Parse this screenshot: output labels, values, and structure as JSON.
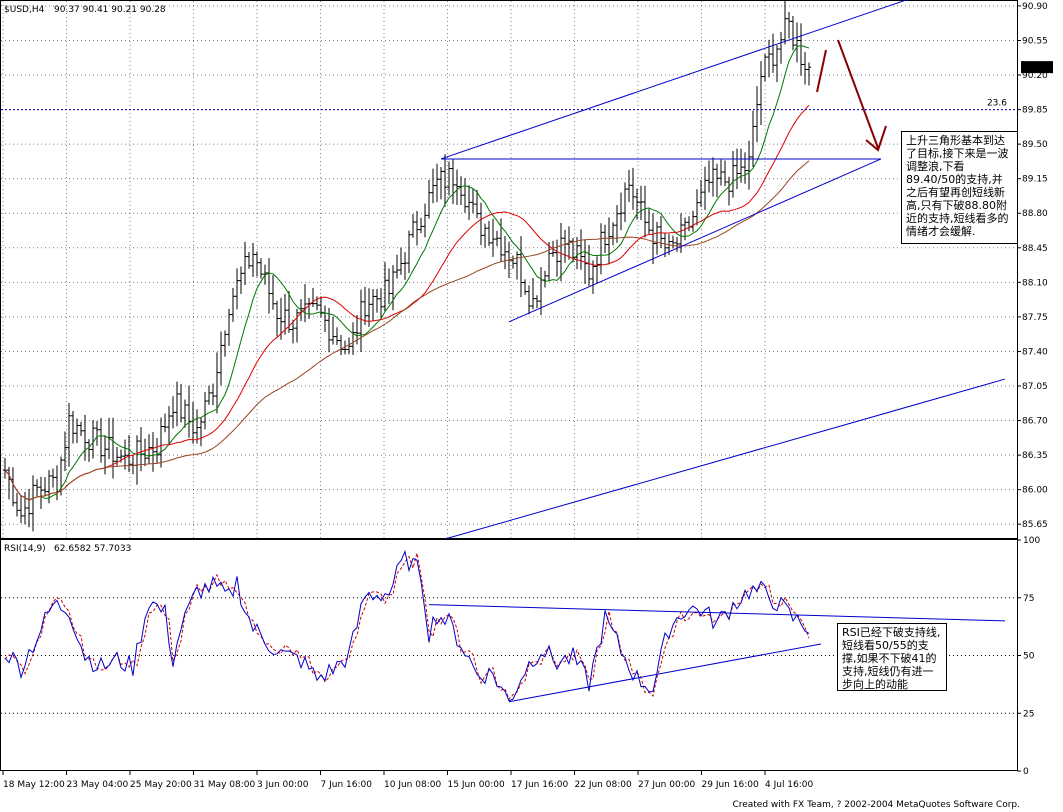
{
  "header": {
    "symbol_title": "$USD,H4",
    "ohlc": "90.37 90.41 90.21 90.28"
  },
  "rsi_header": {
    "title": "RSI(14,9)",
    "values": "62.6582 57.7033"
  },
  "footer": "Created with FX Team, ? 2002-2004 MetaQuotes Software Corp.",
  "annotations": {
    "price_note": "上升三角形基本到达了目标,接下来是一波调整浪,下看89.40/50的支持,并之后有望再创短线新高,只有下破88.80附近的支持,短线看多的情绪才会缓解.",
    "rsi_note": "RSI已经下破支持线,短线看50/55的支撑,如果不下破41的支持,短线仍有进一步向上的动能",
    "fib_label": "23.6"
  },
  "colors": {
    "grid": "#000000",
    "bars": "#000000",
    "ma_fast": "#007700",
    "ma_mid": "#dd0000",
    "ma_slow": "#994422",
    "trendline": "#0000cc",
    "rsi_line": "#0000cc",
    "rsi_signal": "#cc0000",
    "arrow": "#880000",
    "price_box_bg": "#000000",
    "price_box_fg": "#ffffff"
  },
  "chart_data": [
    {
      "type": "line",
      "title": "$USD,H4",
      "chart_style": "ohlc-bars",
      "ylim": [
        85.5,
        90.95
      ],
      "yticks": [
        "90.90",
        "90.55",
        "90.20",
        "89.85",
        "89.50",
        "89.15",
        "88.80",
        "88.45",
        "88.10",
        "87.75",
        "87.40",
        "87.05",
        "86.70",
        "86.35",
        "86.00",
        "85.65"
      ],
      "y_tick_values": [
        90.9,
        90.55,
        90.2,
        89.85,
        89.5,
        89.15,
        88.8,
        88.45,
        88.1,
        87.75,
        87.4,
        87.05,
        86.7,
        86.35,
        86.0,
        85.65
      ],
      "current_price": "90.28",
      "grid": "dotted",
      "x_categories": [
        "18 May 12:00",
        "23 May 04:00",
        "25 May 20:00",
        "31 May 08:00",
        "3 Jun 00:00",
        "7 Jun 16:00",
        "10 Jun 08:00",
        "15 Jun 00:00",
        "17 Jun 16:00",
        "22 Jun 08:00",
        "27 Jun 00:00",
        "29 Jun 16:00",
        "4 Jul 16:00"
      ],
      "close_anchors": [
        [
          0,
          86.2
        ],
        [
          4,
          85.75
        ],
        [
          8,
          86.0
        ],
        [
          13,
          86.1
        ],
        [
          16,
          86.7
        ],
        [
          22,
          86.5
        ],
        [
          30,
          86.3
        ],
        [
          38,
          86.45
        ],
        [
          42,
          86.9
        ],
        [
          48,
          86.6
        ],
        [
          52,
          87.05
        ],
        [
          56,
          87.9
        ],
        [
          62,
          88.4
        ],
        [
          68,
          87.8
        ],
        [
          72,
          87.7
        ],
        [
          78,
          87.8
        ],
        [
          82,
          87.6
        ],
        [
          86,
          87.4
        ],
        [
          90,
          87.9
        ],
        [
          96,
          88.0
        ],
        [
          100,
          88.4
        ],
        [
          104,
          88.8
        ],
        [
          108,
          89.1
        ],
        [
          113,
          89.2
        ],
        [
          118,
          88.7
        ],
        [
          122,
          88.6
        ],
        [
          128,
          88.3
        ],
        [
          132,
          87.9
        ],
        [
          136,
          88.4
        ],
        [
          140,
          88.5
        ],
        [
          146,
          88.2
        ],
        [
          150,
          88.6
        ],
        [
          156,
          89.1
        ],
        [
          160,
          88.7
        ],
        [
          166,
          88.4
        ],
        [
          170,
          88.6
        ],
        [
          176,
          89.1
        ],
        [
          182,
          89.15
        ],
        [
          186,
          89.3
        ],
        [
          189,
          90.2
        ],
        [
          193,
          90.5
        ],
        [
          196,
          90.7
        ],
        [
          199,
          90.4
        ],
        [
          201,
          90.28
        ]
      ],
      "series": [
        {
          "name": "",
          "style": "ohlc-bars"
        },
        {
          "name": "",
          "style": "ma-fast",
          "period": 10
        },
        {
          "name": "",
          "style": "ma-mid",
          "period": 25
        },
        {
          "name": "",
          "style": "ma-slow",
          "period": 50
        }
      ],
      "fib_level": {
        "label": "23.6",
        "y": 89.85
      },
      "trendlines": [
        {
          "from": [
            109,
            89.35
          ],
          "to": [
            226,
            90.97
          ]
        },
        {
          "from": [
            109,
            89.35
          ],
          "to": [
            219,
            89.35
          ]
        },
        {
          "from": [
            126,
            87.7
          ],
          "to": [
            219,
            89.35
          ]
        },
        {
          "from": [
            110,
            85.5
          ],
          "to": [
            250,
            87.12
          ]
        }
      ]
    },
    {
      "type": "line",
      "title": "RSI(14,9)",
      "ylim": [
        0,
        100
      ],
      "yticks": [
        "100",
        "75",
        "50",
        "25",
        "0"
      ],
      "y_tick_values": [
        100,
        75,
        50,
        25,
        0
      ],
      "rsi_anchors": [
        [
          0,
          52
        ],
        [
          4,
          45
        ],
        [
          8,
          58
        ],
        [
          12,
          72
        ],
        [
          16,
          70
        ],
        [
          20,
          50
        ],
        [
          24,
          45
        ],
        [
          28,
          48
        ],
        [
          32,
          45
        ],
        [
          36,
          74
        ],
        [
          40,
          68
        ],
        [
          42,
          48
        ],
        [
          44,
          62
        ],
        [
          48,
          78
        ],
        [
          52,
          80
        ],
        [
          56,
          75
        ],
        [
          58,
          82
        ],
        [
          60,
          70
        ],
        [
          62,
          62
        ],
        [
          66,
          55
        ],
        [
          70,
          50
        ],
        [
          74,
          48
        ],
        [
          78,
          40
        ],
        [
          82,
          44
        ],
        [
          86,
          50
        ],
        [
          90,
          76
        ],
        [
          96,
          77
        ],
        [
          100,
          93
        ],
        [
          104,
          85
        ],
        [
          106,
          60
        ],
        [
          108,
          68
        ],
        [
          111,
          64
        ],
        [
          114,
          55
        ],
        [
          118,
          42
        ],
        [
          122,
          42
        ],
        [
          126,
          30
        ],
        [
          130,
          44
        ],
        [
          134,
          53
        ],
        [
          138,
          47
        ],
        [
          142,
          49
        ],
        [
          146,
          38
        ],
        [
          150,
          66
        ],
        [
          154,
          52
        ],
        [
          158,
          40
        ],
        [
          162,
          36
        ],
        [
          166,
          62
        ],
        [
          170,
          70
        ],
        [
          174,
          70
        ],
        [
          178,
          64
        ],
        [
          182,
          72
        ],
        [
          186,
          78
        ],
        [
          189,
          78
        ],
        [
          193,
          73
        ],
        [
          197,
          66
        ],
        [
          201,
          62
        ]
      ],
      "series": [
        {
          "name": "",
          "style": "rsi"
        },
        {
          "name": "",
          "style": "rsi-signal"
        }
      ],
      "trendlines": [
        {
          "from": [
            106,
            72
          ],
          "to": [
            250,
            65
          ]
        },
        {
          "from": [
            126,
            30
          ],
          "to": [
            204,
            55
          ]
        }
      ]
    }
  ]
}
